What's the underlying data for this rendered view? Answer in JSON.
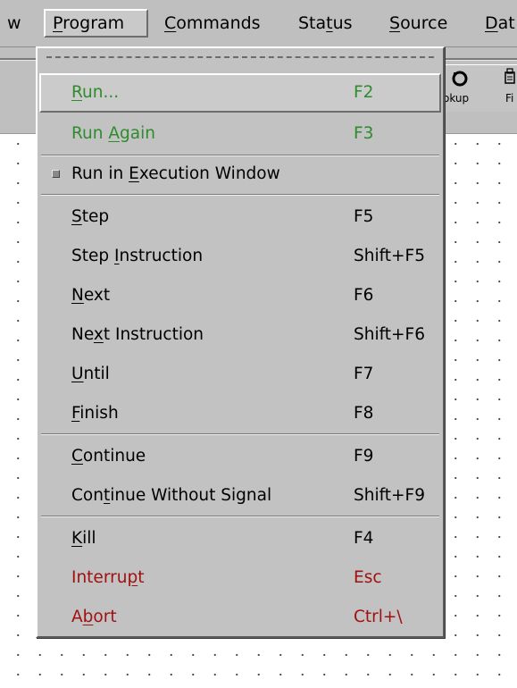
{
  "colors": {
    "menu_bg": "#c2c2c2",
    "green_text": "#2e8b2e",
    "red_text": "#a01010",
    "normal_text": "#000000"
  },
  "menubar": {
    "items": [
      {
        "pre": "",
        "ul": "",
        "post": "w"
      },
      {
        "pre": "",
        "ul": "P",
        "post": "rogram"
      },
      {
        "pre": "",
        "ul": "C",
        "post": "ommands"
      },
      {
        "pre": "Sta",
        "ul": "t",
        "post": "us"
      },
      {
        "pre": "",
        "ul": "S",
        "post": "ource"
      },
      {
        "pre": "",
        "ul": "D",
        "post": "at"
      }
    ]
  },
  "toolbar": {
    "lookup_icon": "undo-circle-icon",
    "lookup_label": "okup",
    "find_icon": "find-icon",
    "find_label": "Fi"
  },
  "menu": {
    "title": "Program",
    "items": [
      {
        "pre": "",
        "ul": "R",
        "post": "un...",
        "accel": "F2",
        "color": "green",
        "active": true
      },
      {
        "pre": "Run ",
        "ul": "A",
        "post": "gain",
        "accel": "F3",
        "color": "green"
      },
      {
        "pre": "Run in ",
        "ul": "E",
        "post": "xecution Window",
        "accel": "",
        "check": true
      },
      {
        "pre": "",
        "ul": "S",
        "post": "tep",
        "accel": "F5"
      },
      {
        "pre": "Step ",
        "ul": "I",
        "post": "nstruction",
        "accel": "Shift+F5"
      },
      {
        "pre": "",
        "ul": "N",
        "post": "ext",
        "accel": "F6"
      },
      {
        "pre": "Ne",
        "ul": "x",
        "post": "t Instruction",
        "accel": "Shift+F6"
      },
      {
        "pre": "",
        "ul": "U",
        "post": "ntil",
        "accel": "F7"
      },
      {
        "pre": "",
        "ul": "F",
        "post": "inish",
        "accel": "F8"
      },
      {
        "pre": "",
        "ul": "C",
        "post": "ontinue",
        "accel": "F9"
      },
      {
        "pre": "Con",
        "ul": "t",
        "post": "inue Without Signal",
        "accel": "Shift+F9"
      },
      {
        "pre": "",
        "ul": "K",
        "post": "ill",
        "accel": "F4"
      },
      {
        "pre": "Interru",
        "ul": "p",
        "post": "t",
        "accel": "Esc",
        "color": "red"
      },
      {
        "pre": "A",
        "ul": "b",
        "post": "ort",
        "accel": "Ctrl+\\",
        "color": "red"
      }
    ]
  }
}
